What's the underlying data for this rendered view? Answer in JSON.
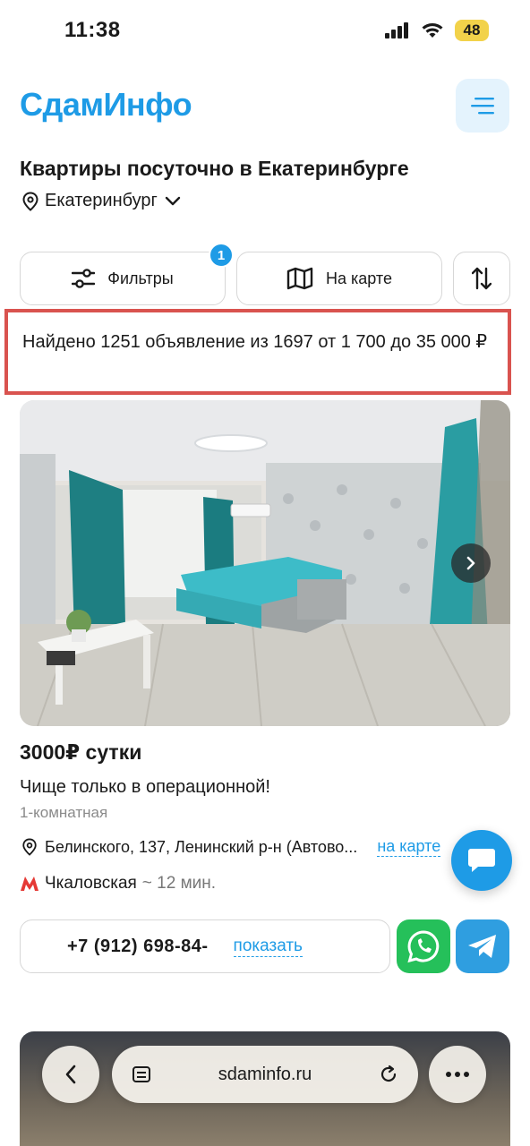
{
  "status_bar": {
    "time": "11:38",
    "battery": "48"
  },
  "header": {
    "logo": "СдамИнфо",
    "menu_icon": "hamburger-icon"
  },
  "page": {
    "title": "Квартиры посуточно в Екатеринбурге",
    "city": "Екатеринбург"
  },
  "toolbar": {
    "filters_label": "Фильтры",
    "filters_badge": "1",
    "map_label": "На карте",
    "sort_icon": "sort-arrows-icon"
  },
  "results": {
    "text": "Найдено 1251 объявление из 1697 от 1 700 до 35 000 ₽"
  },
  "listing": {
    "price": "3000₽ сутки",
    "title": "Чище только в операционной!",
    "rooms": "1-комнатная",
    "address": "Белинского, 137, Ленинский р-н (Автово...",
    "map_link": "на карте",
    "metro_station": "Чкаловская",
    "metro_time": "~ 12 мин.",
    "phone": "+7 (912) 698-84-",
    "show_label": "показать",
    "metro_color": "#e53935"
  },
  "colors": {
    "accent": "#1e9be6",
    "highlight_border": "#d9534f",
    "whatsapp": "#25c05a",
    "telegram": "#2f9ee0"
  },
  "browser": {
    "url": "sdaminfo.ru"
  }
}
